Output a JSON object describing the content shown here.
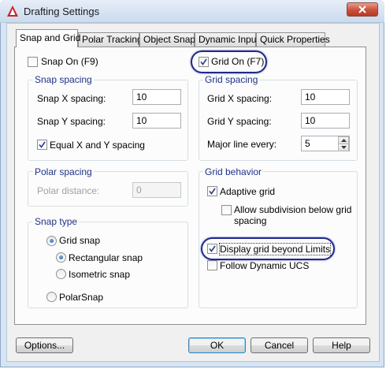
{
  "window": {
    "title": "Drafting Settings"
  },
  "tabs": [
    {
      "label": "Snap and Grid",
      "active": true
    },
    {
      "label": "Polar Tracking",
      "active": false
    },
    {
      "label": "Object Snap",
      "active": false
    },
    {
      "label": "Dynamic Input",
      "active": false
    },
    {
      "label": "Quick Properties",
      "active": false
    }
  ],
  "snap_on": {
    "label": "Snap On (F9)",
    "checked": false
  },
  "grid_on": {
    "label": "Grid On (F7)",
    "checked": true
  },
  "snap_spacing": {
    "title": "Snap spacing",
    "x_label": "Snap X spacing:",
    "x_value": "10",
    "y_label": "Snap Y spacing:",
    "y_value": "10",
    "equal_label": "Equal X and Y spacing",
    "equal_checked": true
  },
  "grid_spacing": {
    "title": "Grid spacing",
    "x_label": "Grid X spacing:",
    "x_value": "10",
    "y_label": "Grid Y spacing:",
    "y_value": "10",
    "major_label": "Major line every:",
    "major_value": "5"
  },
  "polar_spacing": {
    "title": "Polar spacing",
    "distance_label": "Polar distance:",
    "distance_value": "0"
  },
  "snap_type": {
    "title": "Snap type",
    "grid_snap": "Grid snap",
    "rectangular": "Rectangular snap",
    "isometric": "Isometric snap",
    "polar_snap": "PolarSnap",
    "selected_type": "Grid snap",
    "selected_style": "Rectangular snap"
  },
  "grid_behavior": {
    "title": "Grid behavior",
    "adaptive": "Adaptive grid",
    "adaptive_checked": true,
    "subdivision_line1": "Allow subdivision below grid",
    "subdivision_line2": "spacing",
    "subdivision_checked": false,
    "beyond_limits": "Display grid beyond Limits",
    "beyond_limits_checked": true,
    "follow_ucs": "Follow Dynamic UCS",
    "follow_ucs_checked": false
  },
  "buttons": {
    "options": "Options...",
    "ok": "OK",
    "cancel": "Cancel",
    "help": "Help"
  },
  "colors": {
    "group_title": "#1e3287",
    "highlight_ring": "#1f2a8a",
    "close_button": "#c9503a"
  }
}
